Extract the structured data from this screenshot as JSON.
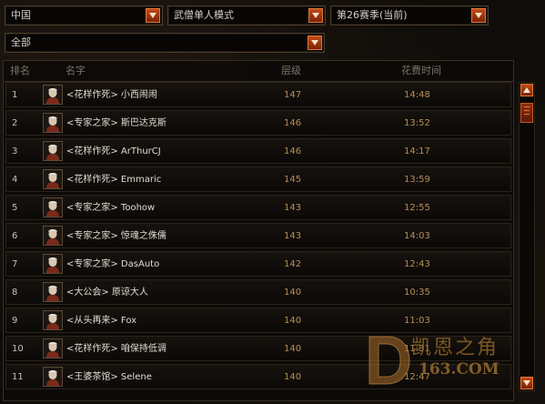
{
  "filters": {
    "region": "中国",
    "mode": "武僧单人模式",
    "season": "第26赛季(当前)",
    "scope": "全部"
  },
  "columns": {
    "rank": "排名",
    "name": "名字",
    "level": "层级",
    "time": "花费时间"
  },
  "rows": [
    {
      "rank": "1",
      "name": "<花样作死> 小西闹闹",
      "level": "147",
      "time": "14:48"
    },
    {
      "rank": "2",
      "name": "<专家之家> 斯巴达克斯",
      "level": "146",
      "time": "13:52"
    },
    {
      "rank": "3",
      "name": "<花样作死> ArThurCJ",
      "level": "146",
      "time": "14:17"
    },
    {
      "rank": "4",
      "name": "<花样作死> Emmaric",
      "level": "145",
      "time": "13:59"
    },
    {
      "rank": "5",
      "name": "<专家之家> Toohow",
      "level": "143",
      "time": "12:55"
    },
    {
      "rank": "6",
      "name": "<专家之家> 惊魂之侏儒",
      "level": "143",
      "time": "14:03"
    },
    {
      "rank": "7",
      "name": "<专家之家> DasAuto",
      "level": "142",
      "time": "12:43"
    },
    {
      "rank": "8",
      "name": "<大公会> 原谅大人",
      "level": "140",
      "time": "10:35"
    },
    {
      "rank": "9",
      "name": "<从头再来> Fox",
      "level": "140",
      "time": "11:03"
    },
    {
      "rank": "10",
      "name": "<花样作死> 咱保持低调",
      "level": "140",
      "time": "11:31"
    },
    {
      "rank": "11",
      "name": "<王婆茶馆> Selene",
      "level": "140",
      "time": "12:47"
    }
  ],
  "icons": {
    "dropdown": "chevron-down-icon",
    "scroll_up": "arrow-up-icon",
    "scroll_down": "arrow-down-icon",
    "portrait": "monk-portrait-icon"
  },
  "colors": {
    "accent": "#c24a17",
    "value_text": "#b98f54",
    "border": "#4b3d2d"
  },
  "watermark": {
    "brand": "凯恩之角",
    "url": "163.COM"
  }
}
